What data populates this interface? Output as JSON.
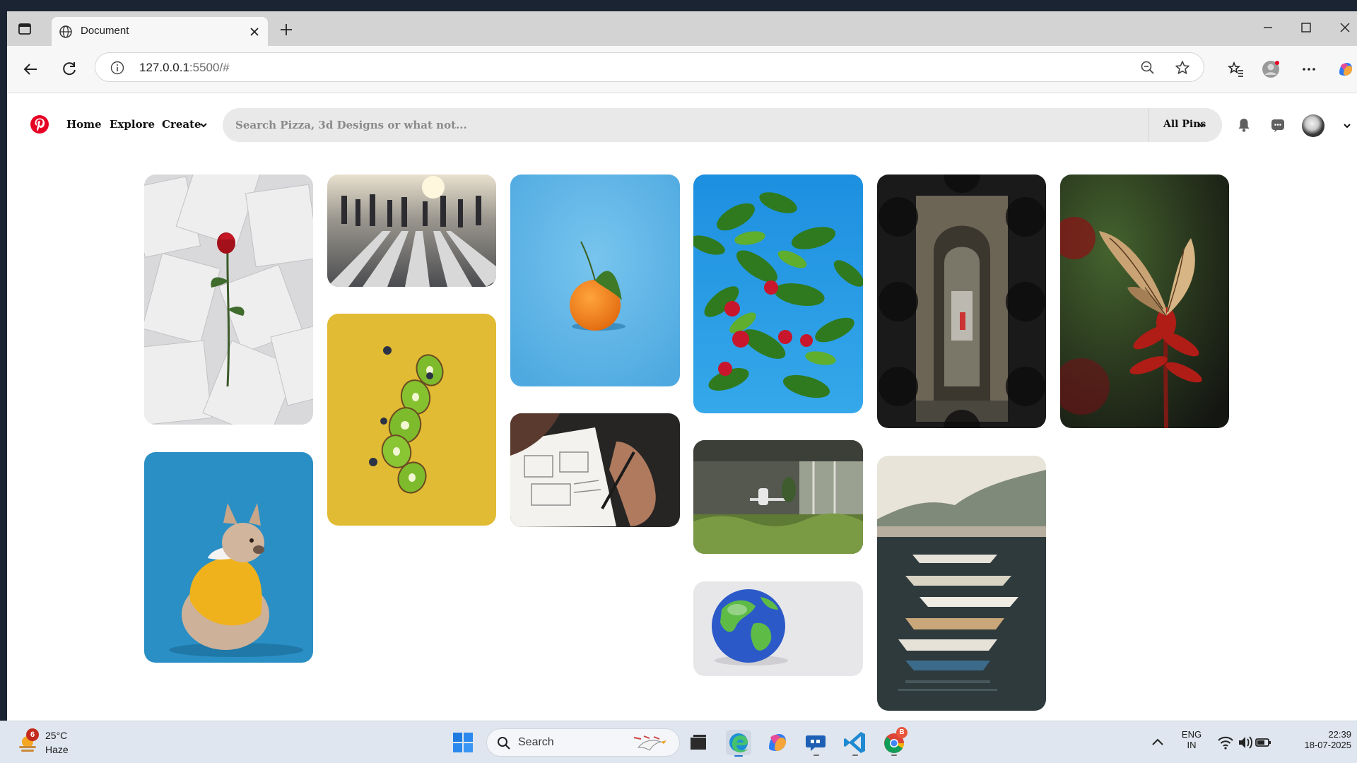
{
  "browser": {
    "tab_title": "Document",
    "url_host": "127.0.0.1",
    "url_rest": ":5500/#"
  },
  "header": {
    "nav": {
      "home": "Home",
      "explore": "Explore",
      "create": "Create"
    },
    "search": {
      "placeholder": "Search Pizza, 3d Designs or what not...",
      "value": ""
    },
    "filter_label": "All Pins"
  },
  "pins": [
    {
      "name": "rose-on-book-pages"
    },
    {
      "name": "crowd-crossing-street"
    },
    {
      "name": "tangerine-on-blue"
    },
    {
      "name": "apple-tree"
    },
    {
      "name": "arched-doorway"
    },
    {
      "name": "butterfly-on-flower"
    },
    {
      "name": "french-bulldog"
    },
    {
      "name": "floating-kiwi-slices"
    },
    {
      "name": "hand-sketching-wireframe"
    },
    {
      "name": "grassy-office-room"
    },
    {
      "name": "globe-3d"
    },
    {
      "name": "harbor-boats"
    }
  ],
  "taskbar": {
    "weather": {
      "badge": "6",
      "temp": "25°C",
      "condition": "Haze"
    },
    "search_label": "Search",
    "chrome_badge": "B",
    "lang_line1": "ENG",
    "lang_line2": "IN",
    "time": "22:39",
    "date": "18-07-2025"
  },
  "colors": {
    "pinterest_red": "#e60023",
    "search_bg": "#e9e9e9",
    "taskbar_bg": "#dfe6ef"
  }
}
